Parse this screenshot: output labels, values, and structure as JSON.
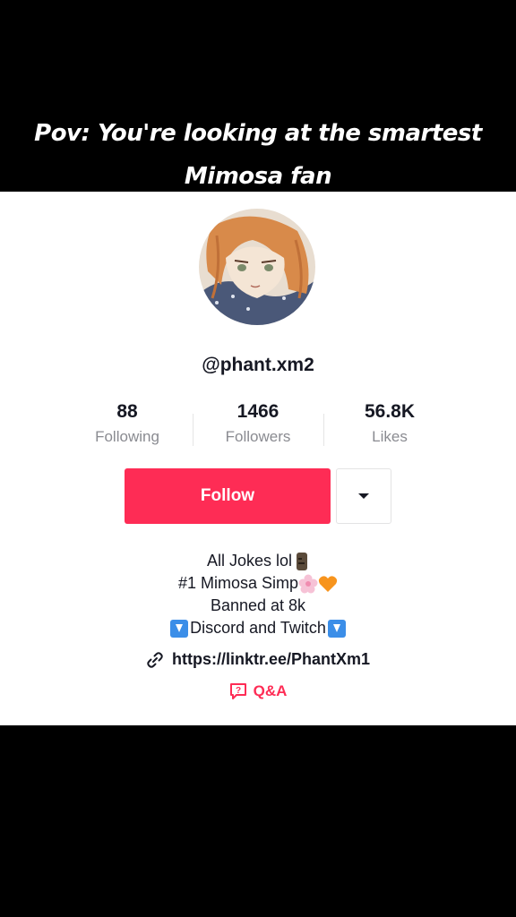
{
  "caption": {
    "line1": "Pov: You're looking at the smartest",
    "line2": "Mimosa fan"
  },
  "profile": {
    "username": "@phant.xm2",
    "avatar_icon": "anime-avatar"
  },
  "stats": [
    {
      "value": "88",
      "label": "Following"
    },
    {
      "value": "1466",
      "label": "Followers"
    },
    {
      "value": "56.8K",
      "label": "Likes"
    }
  ],
  "actions": {
    "follow_label": "Follow",
    "dropdown_icon": "caret-down-icon"
  },
  "bio": {
    "line1": "All Jokes lol",
    "line1_emoji": "moai-icon",
    "line2": "#1 Mimosa Simp",
    "line2_emojis": [
      "cherry-blossom-icon",
      "orange-heart-icon"
    ],
    "line3": "Banned at 8k",
    "line4": "Discord and Twitch",
    "line4_emojis": [
      "down-arrow-icon",
      "down-arrow-icon"
    ]
  },
  "link": {
    "url": "https://linktr.ee/PhantXm1",
    "icon": "link-icon"
  },
  "qa": {
    "label": "Q&A",
    "icon": "qa-icon"
  },
  "colors": {
    "brand": "#fe2c55",
    "text": "#161823",
    "muted": "#8a8b91",
    "bar": "#000000"
  }
}
